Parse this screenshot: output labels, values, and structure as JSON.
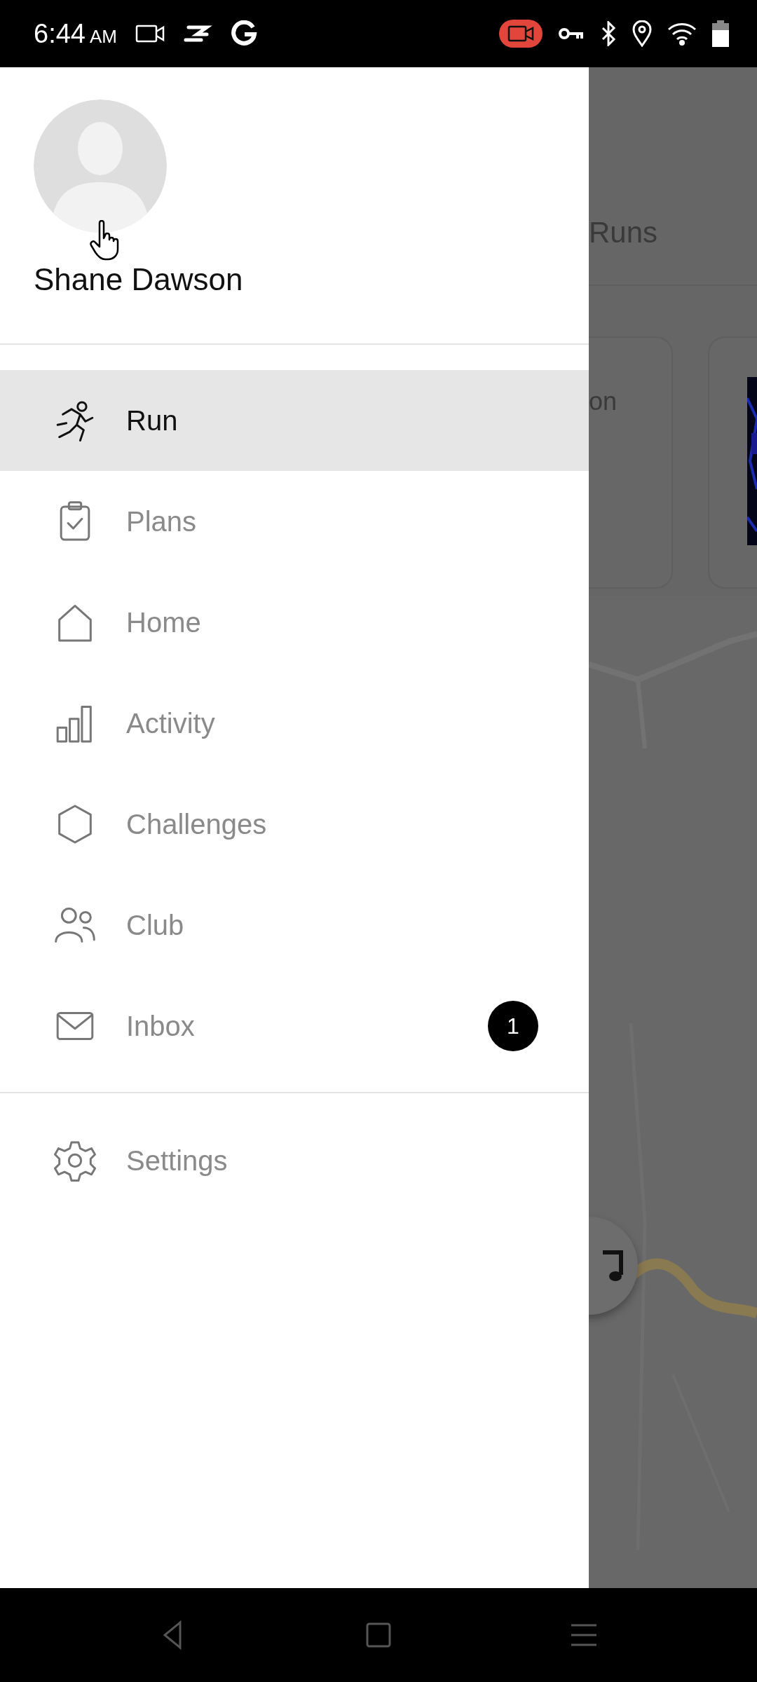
{
  "status_bar": {
    "time": "6:44",
    "period": "AM"
  },
  "drawer": {
    "profile_name": "Shane Dawson",
    "menu": [
      {
        "kind": "run",
        "label": "Run",
        "selected": true
      },
      {
        "kind": "plans",
        "label": "Plans",
        "selected": false
      },
      {
        "kind": "home",
        "label": "Home",
        "selected": false
      },
      {
        "kind": "activity",
        "label": "Activity",
        "selected": false
      },
      {
        "kind": "challenges",
        "label": "Challenges",
        "selected": false
      },
      {
        "kind": "club",
        "label": "Club",
        "selected": false
      },
      {
        "kind": "inbox",
        "label": "Inbox",
        "selected": false,
        "badge": "1"
      }
    ],
    "footer_menu": [
      {
        "kind": "settings",
        "label": "Settings",
        "selected": false
      }
    ]
  },
  "background": {
    "title": "Runs",
    "card_text": "on"
  }
}
